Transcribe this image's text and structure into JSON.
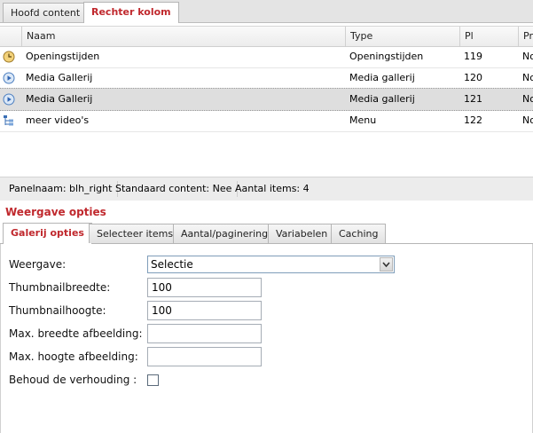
{
  "top_tabs": [
    {
      "label": "Hoofd content",
      "active": false
    },
    {
      "label": "Rechter kolom",
      "active": true
    }
  ],
  "grid": {
    "columns": [
      "Naam",
      "Type",
      "Pl",
      "Pri"
    ],
    "rows": [
      {
        "icon": "clock-icon",
        "naam": "Openingstijden",
        "type": "Openingstijden",
        "pl": "119",
        "pri": "No"
      },
      {
        "icon": "play-icon",
        "naam": "Media Gallerij",
        "type": "Media gallerij",
        "pl": "120",
        "pri": "No"
      },
      {
        "icon": "play-icon",
        "naam": "Media Gallerij",
        "type": "Media gallerij",
        "pl": "121",
        "pri": "No",
        "selected": true
      },
      {
        "icon": "menu-tree-icon",
        "naam": "meer video's",
        "type": "Menu",
        "pl": "122",
        "pri": "No"
      }
    ]
  },
  "status": {
    "panelnaam": "Panelnaam: blh_right",
    "standaard": "Standaard content: Nee",
    "aantal": "Aantal items: 4"
  },
  "section_title": "Weergave opties",
  "sub_tabs": [
    {
      "label": "Galerij opties",
      "active": true
    },
    {
      "label": "Selecteer items",
      "active": false
    },
    {
      "label": "Aantal/paginering",
      "active": false
    },
    {
      "label": "Variabelen",
      "active": false
    },
    {
      "label": "Caching",
      "active": false
    }
  ],
  "form": {
    "weergave_label": "Weergave:",
    "weergave_value": "Selectie",
    "thumb_breedte_label": "Thumbnailbreedte:",
    "thumb_breedte_value": "100",
    "thumb_hoogte_label": "Thumbnailhoogte:",
    "thumb_hoogte_value": "100",
    "max_breedte_label": "Max. breedte afbeelding:",
    "max_breedte_value": "",
    "max_hoogte_label": "Max. hoogte afbeelding:",
    "max_hoogte_value": "",
    "behoud_label": "Behoud de verhouding :",
    "behoud_checked": false
  },
  "colors": {
    "accent": "#c0282d",
    "selected_row": "#dedede"
  }
}
